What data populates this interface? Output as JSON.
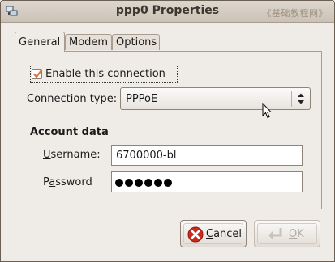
{
  "window": {
    "title": "ppp0 Properties",
    "watermark": "《基础教程网》"
  },
  "tabs": [
    {
      "label": "General",
      "active": true
    },
    {
      "label": "Modem",
      "active": false
    },
    {
      "label": "Options",
      "active": false
    }
  ],
  "general": {
    "enable_connection": {
      "label_mnemonic": "E",
      "label_rest": "nable this connection",
      "checked": true
    },
    "connection_type": {
      "label": "Connection type:",
      "value": "PPPoE"
    },
    "account_section": "Account data",
    "username": {
      "label_mnemonic": "U",
      "label_rest": "sername:",
      "value": "6700000-bl"
    },
    "password": {
      "label_pre": "P",
      "label_mnemonic": "a",
      "label_rest": "ssword",
      "masked_length": 6
    }
  },
  "buttons": {
    "cancel": {
      "label_mnemonic": "C",
      "label_rest": "ancel",
      "enabled": true
    },
    "ok": {
      "label_mnemonic": "O",
      "label_rest": "K",
      "enabled": false
    }
  },
  "icons": {
    "window_icon": "network-window-icon",
    "cancel_icon": "cancel-icon",
    "ok_icon": "ok-arrow-icon",
    "pointer": "mouse-pointer-icon"
  },
  "colors": {
    "check_orange": "#d8753c",
    "cancel_red": "#cc2a1c"
  }
}
